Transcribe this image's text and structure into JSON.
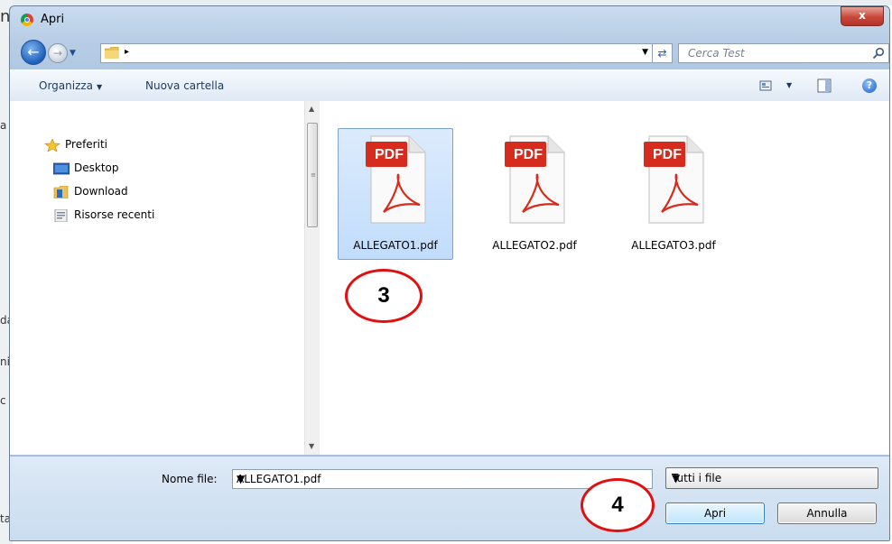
{
  "background_app": {
    "left_fragments": [
      "n",
      "a",
      "da",
      "ni",
      "c",
      "ta"
    ]
  },
  "dialog": {
    "title": "Apri",
    "close_label": "x"
  },
  "navigation": {
    "search_placeholder": "Cerca Test"
  },
  "toolbar": {
    "organize_label": "Organizza",
    "new_folder_label": "Nuova cartella"
  },
  "nav_pane": {
    "items": [
      {
        "label": "Preferiti",
        "icon": "star-icon"
      },
      {
        "label": "Desktop",
        "icon": "desktop-icon"
      },
      {
        "label": "Download",
        "icon": "download-folder-icon"
      },
      {
        "label": "Risorse recenti",
        "icon": "recent-places-icon"
      }
    ]
  },
  "files": [
    {
      "name": "ALLEGATO1.pdf",
      "badge": "PDF",
      "selected": true
    },
    {
      "name": "ALLEGATO2.pdf",
      "badge": "PDF",
      "selected": false
    },
    {
      "name": "ALLEGATO3.pdf",
      "badge": "PDF",
      "selected": false
    }
  ],
  "annotations": {
    "marker_files": "3",
    "marker_open": "4"
  },
  "bottom": {
    "filename_label": "Nome file:",
    "filename_value": "ALLEGATO1.pdf",
    "filetype_value": "Tutti i file",
    "open_label": "Apri",
    "cancel_label": "Annulla"
  },
  "colors": {
    "marker_red": "#e01010",
    "pdf_red": "#d62c1e",
    "selection_blue": "#c1dcfb"
  }
}
